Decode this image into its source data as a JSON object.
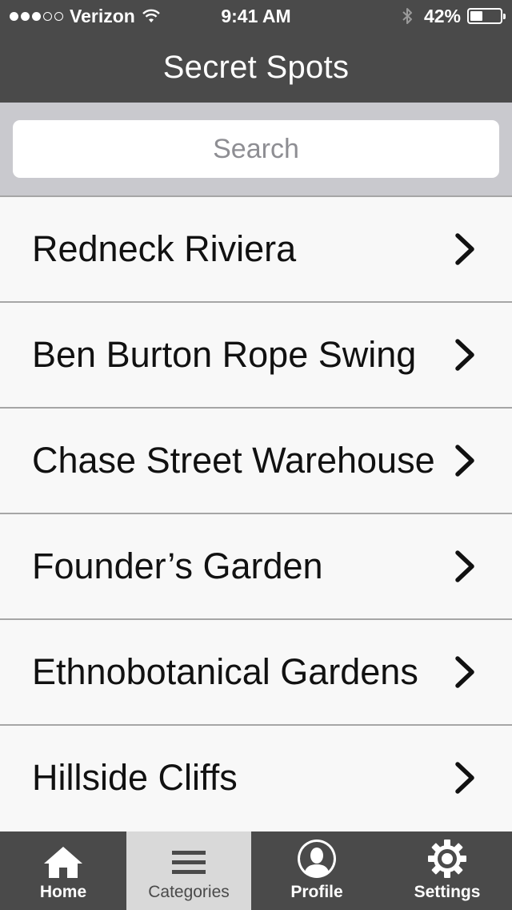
{
  "status_bar": {
    "carrier": "Verizon",
    "time": "9:41 AM",
    "battery": "42%",
    "battery_level": 0.42,
    "signal_bars_filled": 3,
    "signal_bars_total": 5
  },
  "nav": {
    "title": "Secret Spots"
  },
  "search": {
    "placeholder": "Search"
  },
  "list": {
    "items": [
      {
        "label": "Redneck Riviera"
      },
      {
        "label": "Ben Burton Rope Swing"
      },
      {
        "label": "Chase Street Warehouse"
      },
      {
        "label": "Founder’s Garden"
      },
      {
        "label": "Ethnobotanical Gardens"
      },
      {
        "label": "Hillside Cliffs"
      }
    ]
  },
  "tab_bar": {
    "active_tab": "Categories",
    "tabs": [
      {
        "label": "Home",
        "icon": "home-icon"
      },
      {
        "label": "Categories",
        "icon": "list-icon"
      },
      {
        "label": "Profile",
        "icon": "profile-icon"
      },
      {
        "label": "Settings",
        "icon": "gear-icon"
      }
    ]
  },
  "colors": {
    "bar_background": "#4a4a4a",
    "search_area_background": "#c9c9ce",
    "active_tab_background": "#d9d9d9",
    "row_background": "#f8f8f8",
    "placeholder_text": "#8e8e93"
  }
}
